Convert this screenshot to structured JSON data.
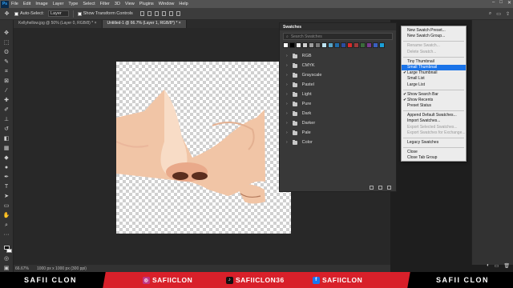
{
  "app": {
    "logo": "Ps"
  },
  "menu": [
    "File",
    "Edit",
    "Image",
    "Layer",
    "Type",
    "Select",
    "Filter",
    "3D",
    "View",
    "Plugins",
    "Window",
    "Help"
  ],
  "options_bar": {
    "auto_select_label": "Auto-Select:",
    "layer_select_value": "Layer",
    "transform_label": "Show Transform Controls"
  },
  "tabs": [
    {
      "label": "Kellyhellow.jpg @ 50% (Layer 0, RGB/8) *",
      "close": "×"
    },
    {
      "label": "Untitled-1 @ 66.7% (Layer 1, RGB/8*) *",
      "close": "×"
    }
  ],
  "status_bar": {
    "zoom": "66.67%",
    "doc_size": "1000 px x 1000 px (300 ppi)"
  },
  "swatches_panel": {
    "title": "Swatches",
    "search_placeholder": "Search Swatches",
    "recent_colors": [
      "#ffffff",
      "#000000",
      "#e8e8e8",
      "#cfcfcf",
      "#9e9e9e",
      "#7a7a7a",
      "#bfe3f1",
      "#5aa5c8",
      "#1e6aa7",
      "#2a4da0",
      "#d92b2b",
      "#9c3a3a",
      "#3a6b3a",
      "#7a3a8f",
      "#3a5fbf",
      "#1aa0d8"
    ],
    "groups": [
      "RGB",
      "CMYK",
      "Grayscale",
      "Pastel",
      "Light",
      "Pure",
      "Dark",
      "Darker",
      "Pale",
      "Color"
    ]
  },
  "flyout_menu": {
    "items": [
      {
        "label": "New Swatch Preset...",
        "state": "normal",
        "checked": false
      },
      {
        "label": "New Swatch Group...",
        "state": "normal",
        "checked": false
      },
      {
        "sep": true
      },
      {
        "label": "Rename Swatch...",
        "state": "disabled",
        "checked": false
      },
      {
        "label": "Delete Swatch...",
        "state": "disabled",
        "checked": false
      },
      {
        "sep": true
      },
      {
        "label": "Tiny Thumbnail",
        "state": "normal",
        "checked": false
      },
      {
        "label": "Small Thumbnail",
        "state": "highlight",
        "checked": false
      },
      {
        "label": "Large Thumbnail",
        "state": "normal",
        "checked": true
      },
      {
        "label": "Small List",
        "state": "normal",
        "checked": false
      },
      {
        "label": "Large List",
        "state": "normal",
        "checked": false
      },
      {
        "sep": true
      },
      {
        "label": "Show Search Bar",
        "state": "normal",
        "checked": true
      },
      {
        "label": "Show Recents",
        "state": "normal",
        "checked": true
      },
      {
        "label": "Preset Status",
        "state": "normal",
        "checked": false
      },
      {
        "sep": true
      },
      {
        "label": "Append Default Swatches...",
        "state": "normal",
        "checked": false
      },
      {
        "label": "Import Swatches...",
        "state": "normal",
        "checked": false
      },
      {
        "label": "Export Selected Swatches...",
        "state": "disabled",
        "checked": false
      },
      {
        "label": "Export Swatches for Exchange...",
        "state": "disabled",
        "checked": false
      },
      {
        "sep": true
      },
      {
        "label": "Legacy Swatches",
        "state": "normal",
        "checked": false
      },
      {
        "sep": true
      },
      {
        "label": "Close",
        "state": "normal",
        "checked": false
      },
      {
        "label": "Close Tab Group",
        "state": "normal",
        "checked": false
      }
    ]
  },
  "banner": {
    "brand_left": "SAFII CLON",
    "brand_right": "SAFII CLON",
    "instagram": "SAFIICLON",
    "tiktok": "SAFIICLON36",
    "facebook": "SAFIICLON"
  },
  "colors": {
    "accent": "#1a73e8",
    "banner_red": "#d8202a",
    "skin": "#f1c5a6"
  }
}
